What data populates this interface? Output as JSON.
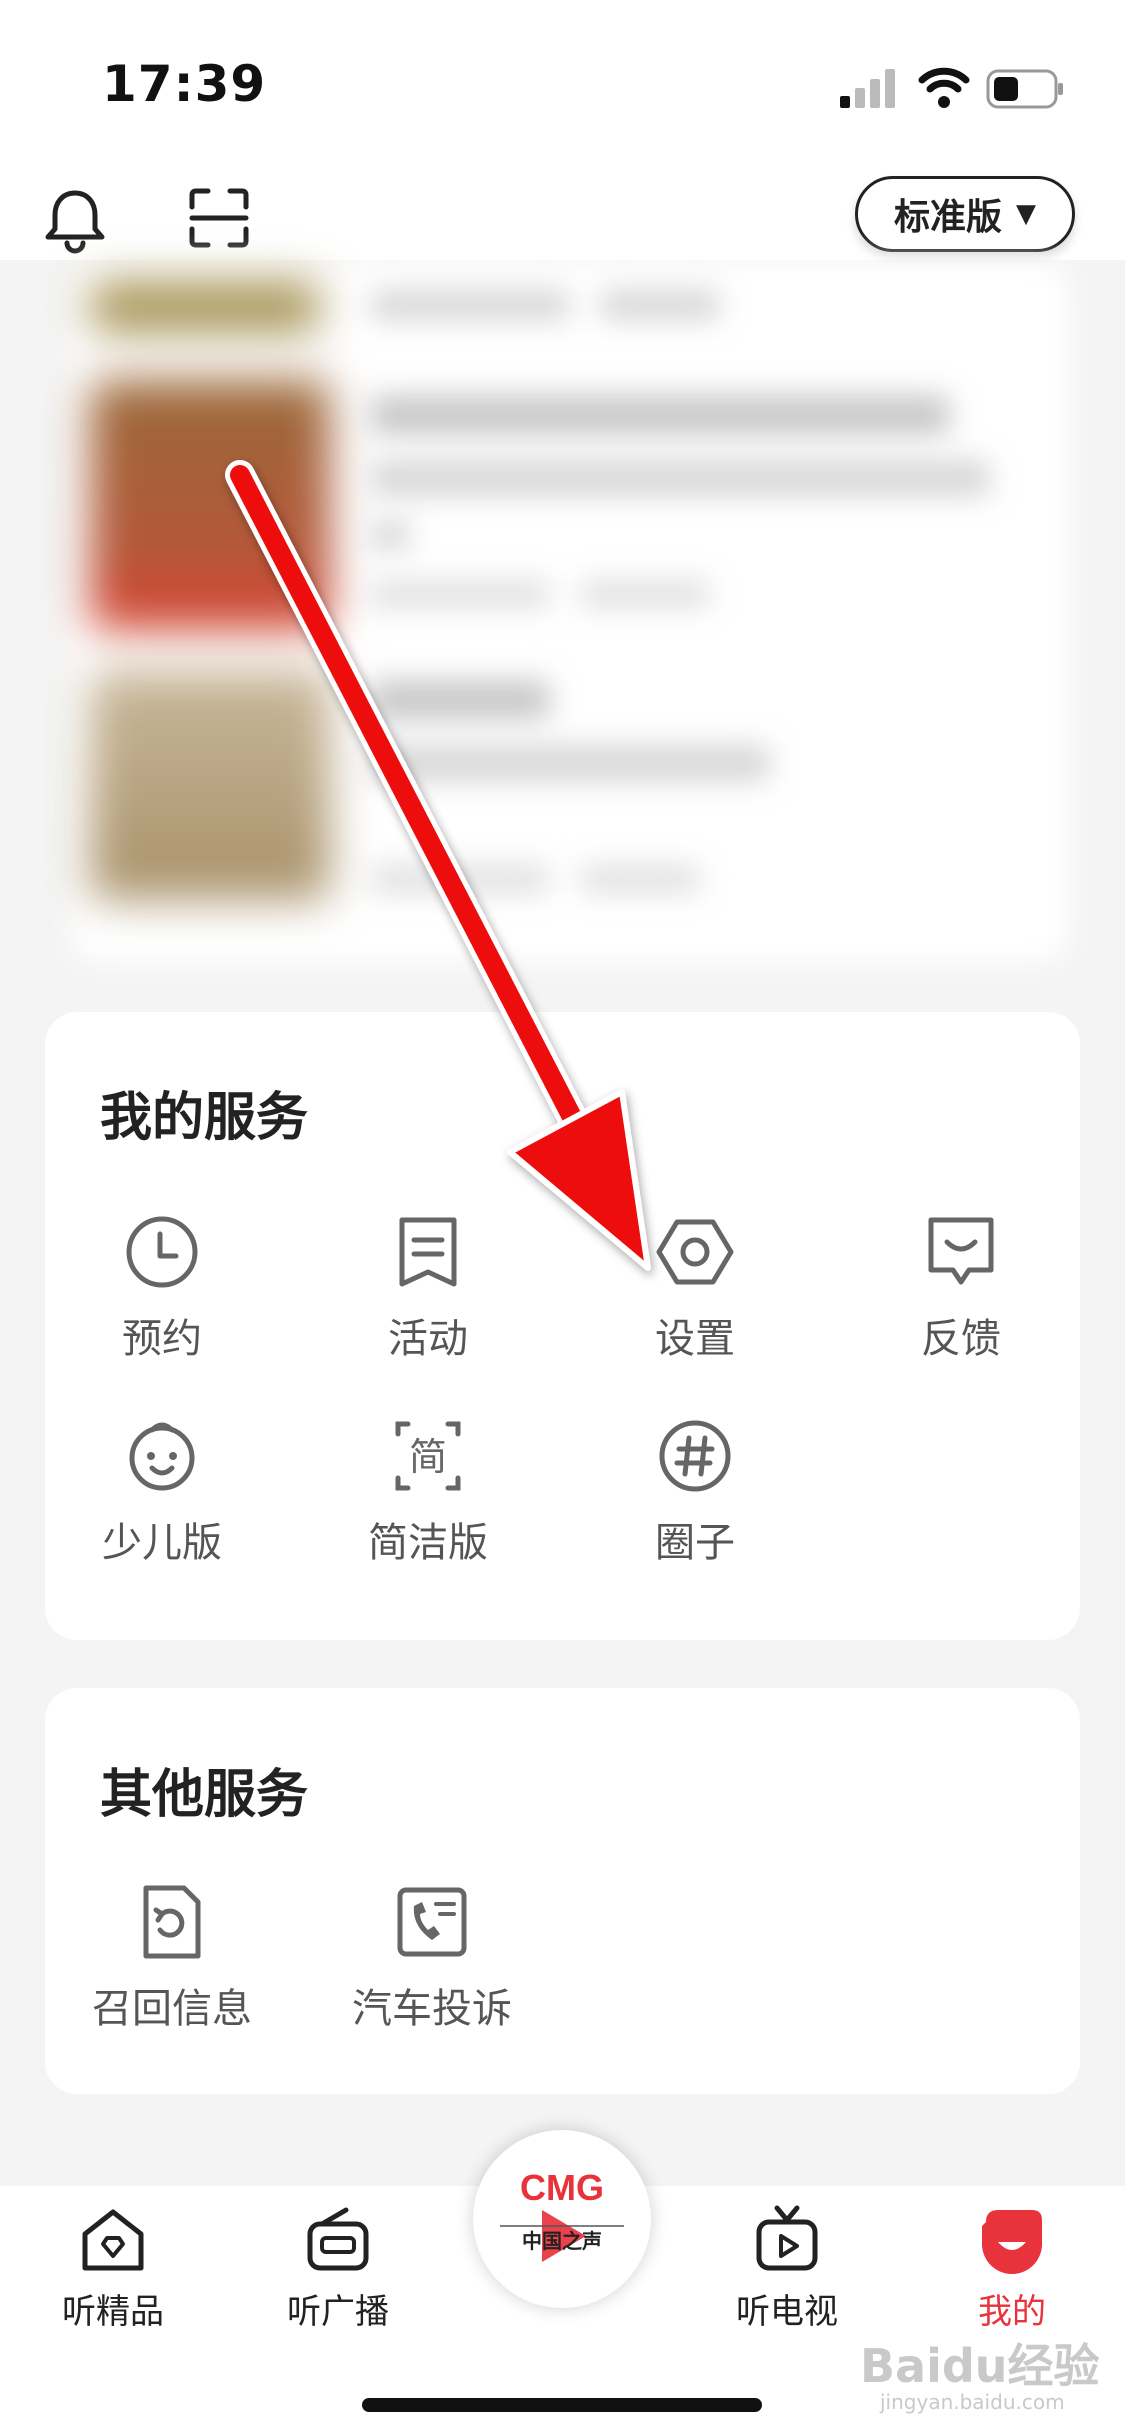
{
  "status_bar": {
    "time": "17:39"
  },
  "header": {
    "edition_label": "标准版"
  },
  "my_services": {
    "title": "我的服务",
    "items": [
      {
        "label": "预约",
        "icon": "clock-icon"
      },
      {
        "label": "活动",
        "icon": "bookmark-list-icon"
      },
      {
        "label": "设置",
        "icon": "hexagon-gear-icon"
      },
      {
        "label": "反馈",
        "icon": "feedback-icon"
      },
      {
        "label": "少儿版",
        "icon": "kid-face-icon"
      },
      {
        "label": "简洁版",
        "icon": "simple-mode-icon"
      },
      {
        "label": "圈子",
        "icon": "hashtag-icon"
      }
    ],
    "simple_mode_glyph": "简"
  },
  "other_services": {
    "title": "其他服务",
    "items": [
      {
        "label": "召回信息",
        "icon": "recall-document-icon"
      },
      {
        "label": "汽车投诉",
        "icon": "phone-complaint-icon"
      }
    ]
  },
  "bottom_nav": {
    "items": [
      {
        "label": "听精品",
        "icon": "home-icon"
      },
      {
        "label": "听广播",
        "icon": "radio-icon"
      },
      {
        "label": "听电视",
        "icon": "tv-icon"
      },
      {
        "label": "我的",
        "icon": "profile-icon",
        "active": true
      }
    ],
    "center": {
      "logo_text": "CMG",
      "sub_text": "中国之声"
    }
  },
  "watermark": {
    "text": "Baidu经验",
    "sub": "jingyan.baidu.com"
  },
  "colors": {
    "accent": "#e8323c",
    "text": "#222222",
    "muted": "#555555",
    "background": "#f4f4f4"
  }
}
